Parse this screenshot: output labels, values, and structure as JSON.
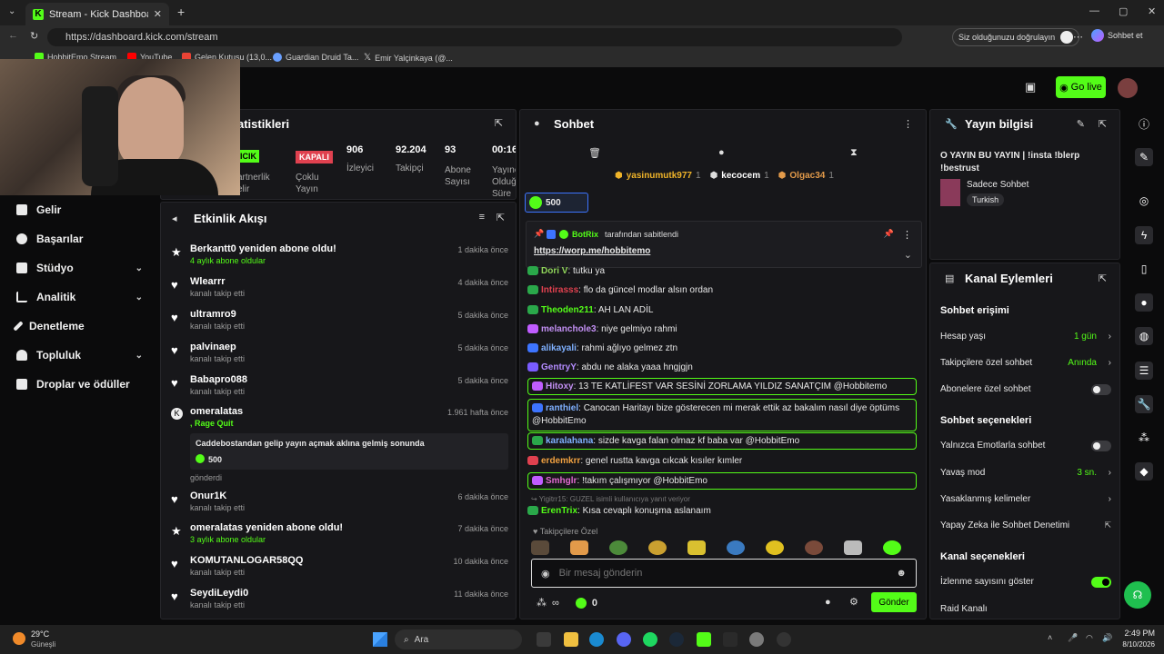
{
  "browser": {
    "tab_title": "Stream - Kick Dashboard",
    "url": "https://dashboard.kick.com/stream",
    "profile_status": "Siz olduğunuzu doğrulayın",
    "chat_btn": "Sohbet et",
    "bookmarks": [
      "HobbitEmo Stream",
      "YouTube",
      "Gelen Kutusu (13,0...",
      "Guardian Druid Ta...",
      "Emir Yalçinkaya (@..."
    ]
  },
  "topnav": {
    "golive": "Go live"
  },
  "leftnav": {
    "items": [
      {
        "label": "Gelir"
      },
      {
        "label": "Başarılar"
      },
      {
        "label": "Stüdyo"
      },
      {
        "label": "Analitik"
      },
      {
        "label": "Denetleme"
      },
      {
        "label": "Topluluk"
      },
      {
        "label": "Droplar ve ödüller"
      }
    ]
  },
  "stats": {
    "title": "atistikleri",
    "partner_badge": "ICIK",
    "partner_label": "artnerlik\nelir",
    "multi_badge": "KAPALI",
    "multi_label": "Çoklu\nYayın",
    "viewers": "906",
    "viewers_label": "İzleyici",
    "followers": "92.204",
    "followers_label": "Takipçi",
    "subs": "93",
    "subs_label": "Abone\nSayısı",
    "duration": "00:16:",
    "duration_label": "Yayınc\nOlduğu\nSüre"
  },
  "activity": {
    "title": "Etkinlik Akışı",
    "items": [
      {
        "name": "Berkantt0 yeniden abone oldu!",
        "sub": "4 aylık abone oldular",
        "time": "1 dakika önce"
      },
      {
        "name": "Wlearrr",
        "sub": "kanalı takip etti",
        "time": "4 dakika önce"
      },
      {
        "name": "ultramro9",
        "sub": "kanalı takip etti",
        "time": "5 dakika önce"
      },
      {
        "name": "palvinaep",
        "sub": "kanalı takip etti",
        "time": "5 dakika önce"
      },
      {
        "name": "Babapro088",
        "sub": "kanalı takip etti",
        "time": "5 dakika önce"
      },
      {
        "name": "omeralatas",
        "sub": ", Rage Quit",
        "time": "1.961 hafta önce",
        "message": "Caddebostandan gelip yayın açmak aklına gelmiş sonunda",
        "amount": "500",
        "sent": "gönderdi"
      },
      {
        "name": "Onur1K",
        "sub": "kanalı takip etti",
        "time": "6 dakika önce"
      },
      {
        "name": "omeralatas yeniden abone oldu!",
        "sub": "3 aylık abone oldular",
        "time": "7 dakika önce"
      },
      {
        "name": "KOMUTANLOGAR58QQ",
        "sub": "kanalı takip etti",
        "time": "10 dakika önce"
      },
      {
        "name": "SeydiLeydi0",
        "sub": "kanalı takip etti",
        "time": "11 dakika önce"
      }
    ]
  },
  "chat": {
    "title": "Sohbet",
    "top_gifters": [
      {
        "name": "yasinumutk977",
        "count": "1"
      },
      {
        "name": "kecocem",
        "count": "1"
      },
      {
        "name": "Olgac34",
        "count": "1"
      }
    ],
    "kicks_pill": "500",
    "pinned_by": "BotRix",
    "pinned_suffix": "tarafından sabitlendi",
    "pinned_link": "https://worp.me/hobbitemo",
    "messages": [
      {
        "user": "Dori V",
        "text": "tutku ya",
        "color": "#8fd35a",
        "hl": false
      },
      {
        "user": "Intirasss",
        "text": "flo da güncel modlar alsın ordan",
        "color": "#e0414f",
        "hl": false
      },
      {
        "user": "Theoden211",
        "text": "AH LAN ADİL",
        "color": "#53fc18",
        "hl": false
      },
      {
        "user": "melanchole3",
        "text": "niye gelmiyo rahmi",
        "color": "#c28ff3",
        "hl": false
      },
      {
        "user": "alikayali",
        "text": "rahmi ağlıyo gelmez ztn",
        "color": "#7fb0ff",
        "hl": false
      },
      {
        "user": "GentryY",
        "text": "abdu ne alaka yaaa hngjgjn",
        "color": "#b48cff",
        "hl": false
      },
      {
        "user": "Hitoxy",
        "text": "13 TE KATLİFEST VAR SESİNİ ZORLAMA YILDIZ SANATÇIM @Hobbitemo",
        "color": "#c28ff3",
        "hl": true
      },
      {
        "user": "ranthiel",
        "text": "Canocan Haritayı bize gösterecen mi merak ettik az bakalım nasıl diye öptüms @HobbitEmo",
        "color": "#7fb0ff",
        "hl": true
      },
      {
        "user": "karalahana",
        "text": "sizde kavga falan olmaz kf baba var @HobbitEmo",
        "color": "#7fb0ff",
        "hl": true
      },
      {
        "user": "erdemkrr",
        "text": "genel rustta kavga cıkcak kısıler kımler",
        "color": "#f0a040",
        "hl": false
      },
      {
        "user": "Smhglr",
        "text": "!takım çalışmıyor @HobbitEmo",
        "color": "#e06ad0",
        "hl": true
      }
    ],
    "reply_hint": "Yigitrr15: GUZEL isimli kullanıcıya yanıt veriyor",
    "reply_user": "ErenTrix",
    "reply_text": "Kısa cevaplı konuşma aslanaım",
    "followers_only": "Takipçilere Özel",
    "input_placeholder": "Bir mesaj gönderin",
    "kicks_count": "0",
    "send": "Gönder"
  },
  "info": {
    "title": "Yayın bilgisi",
    "stream_title": "O YAYIN BU YAYIN | !insta !blerp !bestrust",
    "category": "Sadece Sohbet",
    "language": "Turkish"
  },
  "actions": {
    "title": "Kanal Eylemleri",
    "access_title": "Sohbet erişimi",
    "account_age": "Hesap yaşı",
    "account_age_val": "1 gün",
    "followers_chat": "Takipçilere özel sohbet",
    "followers_chat_val": "Anında",
    "subs_chat": "Abonelere özel sohbet",
    "options_title": "Sohbet seçenekleri",
    "emote_only": "Yalnızca Emotlarla sohbet",
    "slow_mode": "Yavaş mod",
    "slow_mode_val": "3 sn.",
    "banned_words": "Yasaklanmış kelimeler",
    "ai_mod": "Yapay Zeka ile Sohbet Denetimi",
    "channel_title": "Kanal seçenekleri",
    "show_viewers": "İzlenme sayısını göster",
    "raid": "Raid Kanalı"
  },
  "taskbar": {
    "weather_temp": "29°C",
    "weather_desc": "Güneşli",
    "search": "Ara",
    "time": "2:49 PM",
    "date": "8/10/2026"
  },
  "colors": {
    "accent": "#53fc18",
    "panel": "#17171a",
    "bg": "#0b0b0c",
    "live": "#e0414f"
  }
}
